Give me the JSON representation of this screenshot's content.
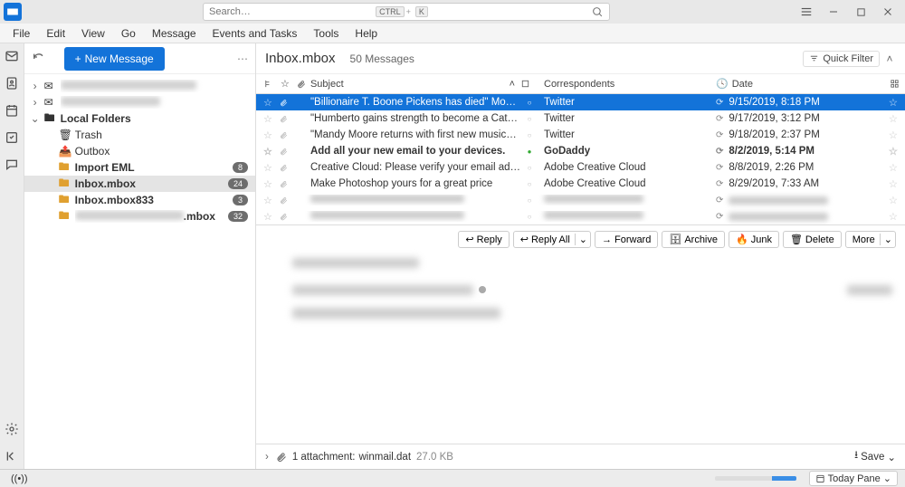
{
  "search": {
    "placeholder": "Search…",
    "kbd1": "CTRL",
    "kbd2": "K"
  },
  "menu": {
    "file": "File",
    "edit": "Edit",
    "view": "View",
    "go": "Go",
    "message": "Message",
    "events": "Events and Tasks",
    "tools": "Tools",
    "help": "Help"
  },
  "newMessage": "New Message",
  "tree": {
    "localFolders": "Local Folders",
    "trash": "Trash",
    "outbox": "Outbox",
    "importEml": "Import EML",
    "importEmlBadge": "8",
    "inboxMbox": "Inbox.mbox",
    "inboxMboxBadge": "24",
    "inboxMbox833": "Inbox.mbox833",
    "inboxMbox833Badge": "3",
    "blurredTail": ".mbox",
    "blurredBadge": "32"
  },
  "content": {
    "title": "Inbox.mbox",
    "count": "50 Messages",
    "quickFilter": "Quick Filter"
  },
  "cols": {
    "subject": "Subject",
    "correspondents": "Correspondents",
    "date": "Date"
  },
  "msgs": [
    {
      "subject": "\"Billionaire T. Boone Pickens has died\" Mo…",
      "corr": "Twitter",
      "date": "9/15/2019, 8:18 PM",
      "sel": true
    },
    {
      "subject": "\"Humberto gains strength to become a Cat…",
      "corr": "Twitter",
      "date": "9/17/2019, 3:12 PM"
    },
    {
      "subject": "\"Mandy Moore returns with first new music…",
      "corr": "Twitter",
      "date": "9/18/2019, 2:37 PM"
    },
    {
      "subject": "Add all your new email to your devices.",
      "corr": "GoDaddy",
      "date": "8/2/2019, 5:14 PM",
      "bold": true,
      "dot": "g"
    },
    {
      "subject": "Creative Cloud: Please verify your email ad…",
      "corr": "Adobe Creative Cloud",
      "date": "8/8/2019, 2:26 PM"
    },
    {
      "subject": "Make Photoshop yours for a great price",
      "corr": "Adobe Creative Cloud",
      "date": "8/29/2019, 7:33 AM"
    }
  ],
  "actions": {
    "reply": "Reply",
    "replyAll": "Reply All",
    "forward": "Forward",
    "archive": "Archive",
    "junk": "Junk",
    "delete": "Delete",
    "more": "More"
  },
  "attach": {
    "label": "1 attachment:",
    "name": "winmail.dat",
    "size": "27.0 KB",
    "save": "Save"
  },
  "status": {
    "today": "Today Pane"
  }
}
